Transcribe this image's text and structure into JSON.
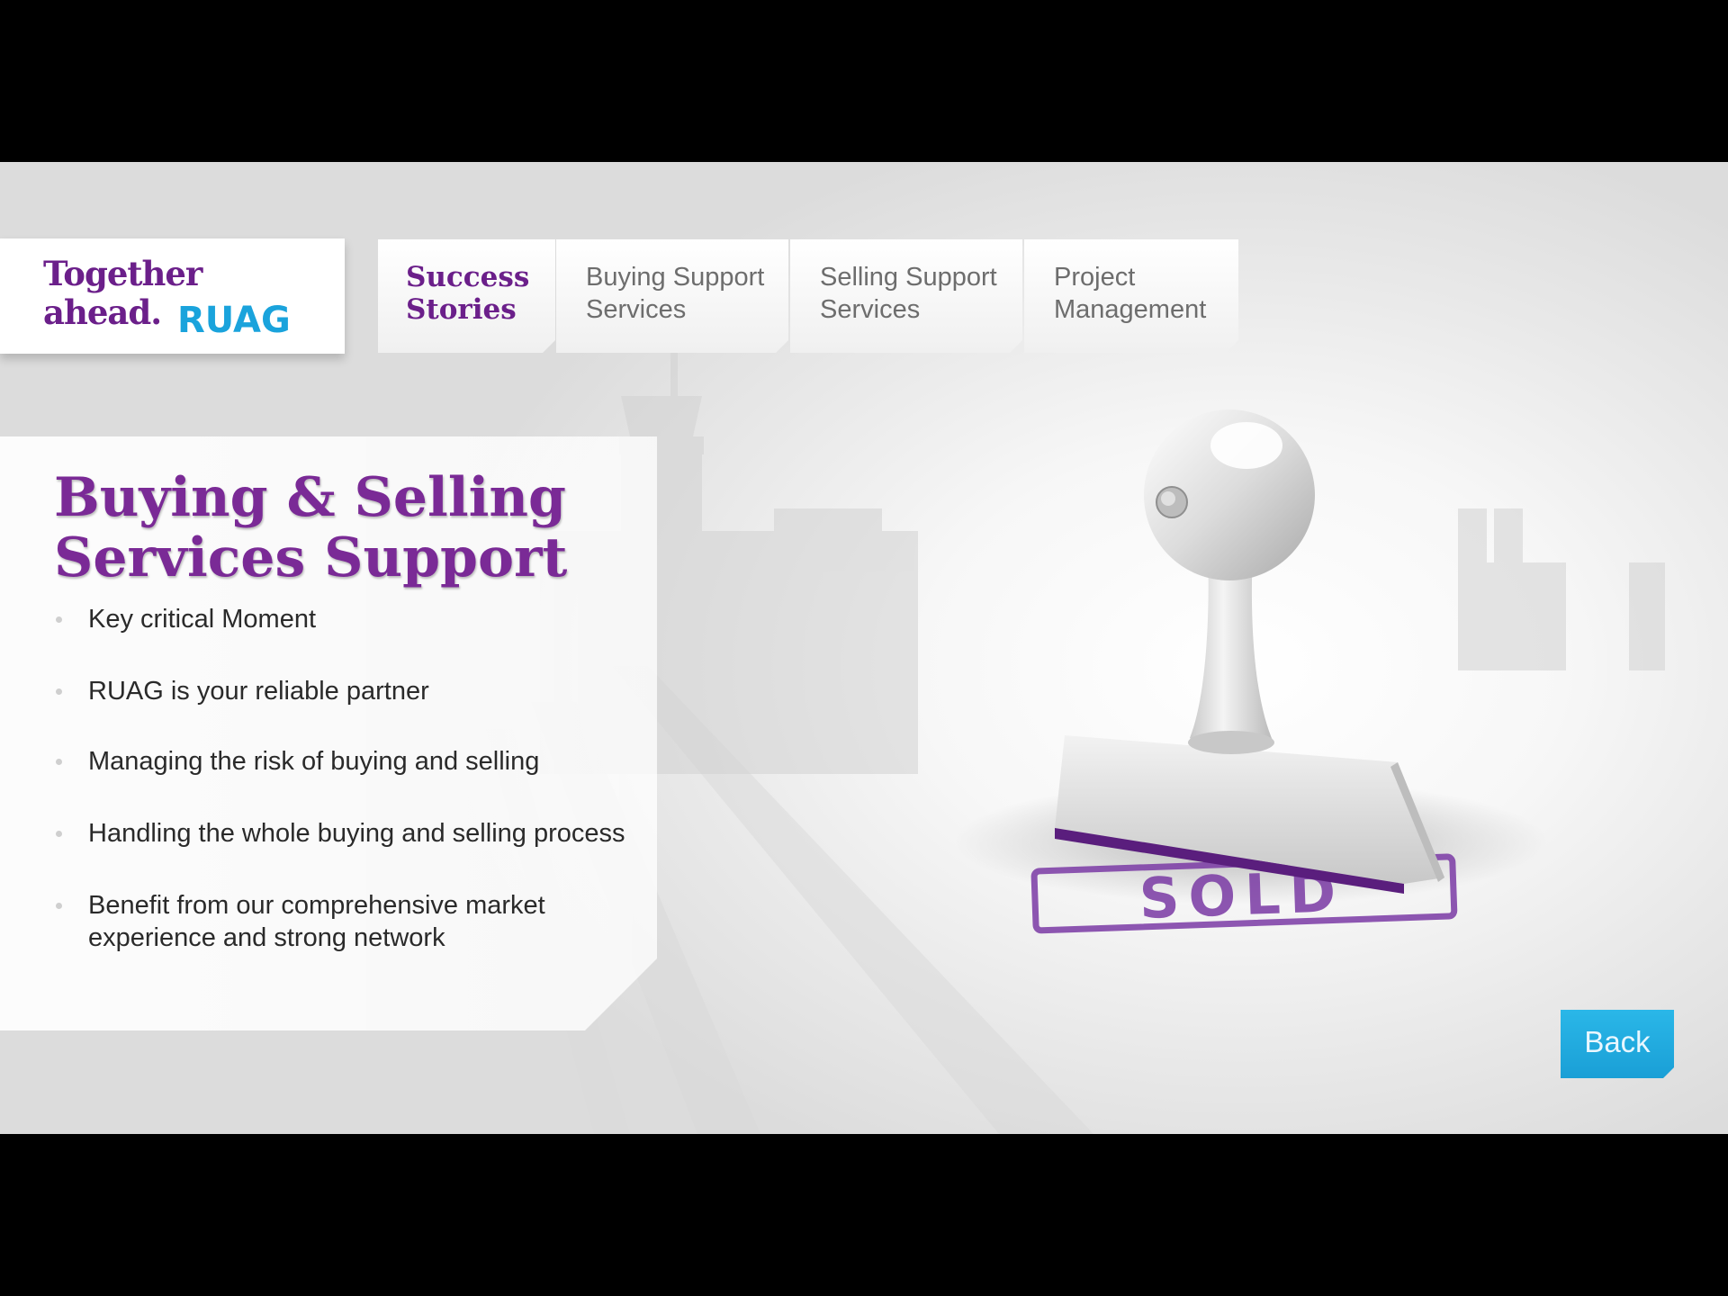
{
  "brand": {
    "tagline": "Together\nahead.",
    "name": "RUAG"
  },
  "nav": {
    "tabs": [
      {
        "label": "Success\nStories",
        "active": true
      },
      {
        "label": "Buying Support\nServices",
        "active": false
      },
      {
        "label": "Selling Support\nServices",
        "active": false
      },
      {
        "label": "Project\nManagement",
        "active": false
      }
    ]
  },
  "main": {
    "title": "Buying & Selling\nServices Support",
    "bullets": [
      "Key critical Moment",
      "RUAG is your reliable partner",
      "Managing the risk of buying and selling",
      "Handling the whole buying and selling process",
      "Benefit from our comprehensive market\nexperience and strong network"
    ]
  },
  "illustration": {
    "stamp_text": "SOLD",
    "icon": "rubber-stamp-icon"
  },
  "actions": {
    "back_label": "Back"
  },
  "colors": {
    "brand_purple": "#6b1f8a",
    "brand_blue": "#1aa3dc",
    "back_button": "#22abe2"
  }
}
